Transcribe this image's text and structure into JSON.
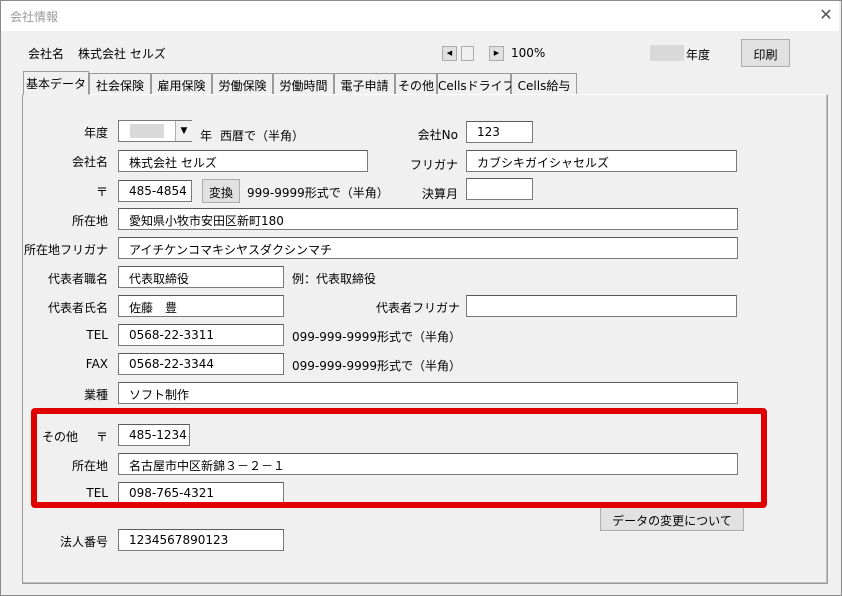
{
  "window": {
    "title": "会社情報",
    "close_icon": "close-icon"
  },
  "header": {
    "company_label": "会社名",
    "company_value": "株式会社 セルズ",
    "zoom": "100%",
    "year_suffix": "年度",
    "print_label": "印刷"
  },
  "tabs": [
    "基本データ",
    "社会保険",
    "雇用保険",
    "労働保険",
    "労働時間",
    "電子申請",
    "その他",
    "Cellsドライブ",
    "Cells給与"
  ],
  "form": {
    "year_label": "年度",
    "year_unit": "年",
    "year_hint": "西暦で（半角）",
    "company_no_label": "会社No",
    "company_no_value": "123",
    "name_label": "会社名",
    "name_value": "株式会社 セルズ",
    "furigana_label": "フリガナ",
    "furigana_value": "カブシキガイシャセルズ",
    "postal_label": "〒",
    "postal_value": "485-4854",
    "convert_label": "変換",
    "postal_hint": "999-9999形式で（半角）",
    "closing_month_label": "決算月",
    "closing_month_value": "",
    "address_label": "所在地",
    "address_value": "愛知県小牧市安田区新町180",
    "address_kana_label": "所在地フリガナ",
    "address_kana_value": "アイチケンコマキシヤスダクシンマチ",
    "rep_title_label": "代表者職名",
    "rep_title_value": "代表取締役",
    "rep_title_hint": "例：代表取締役",
    "rep_name_label": "代表者氏名",
    "rep_name_value": "佐藤　豊",
    "rep_kana_label": "代表者フリガナ",
    "rep_kana_value": "",
    "tel_label": "TEL",
    "tel_value": "0568-22-3311",
    "tel_hint": "099-999-9999形式で（半角）",
    "fax_label": "FAX",
    "fax_value": "0568-22-3344",
    "fax_hint": "099-999-9999形式で（半角）",
    "industry_label": "業種",
    "industry_value": "ソフト制作",
    "other_label": "その他",
    "other_postal_label": "〒",
    "other_postal_value": "485-1234",
    "other_address_label": "所在地",
    "other_address_value": "名古屋市中区新錦３－２－１",
    "other_tel_label": "TEL",
    "other_tel_value": "098-765-4321",
    "data_change_label": "データの変更について",
    "corp_no_label": "法人番号",
    "corp_no_value": "1234567890123"
  },
  "colors": {
    "highlight": "#e10000",
    "background": "#f0f0f0"
  }
}
